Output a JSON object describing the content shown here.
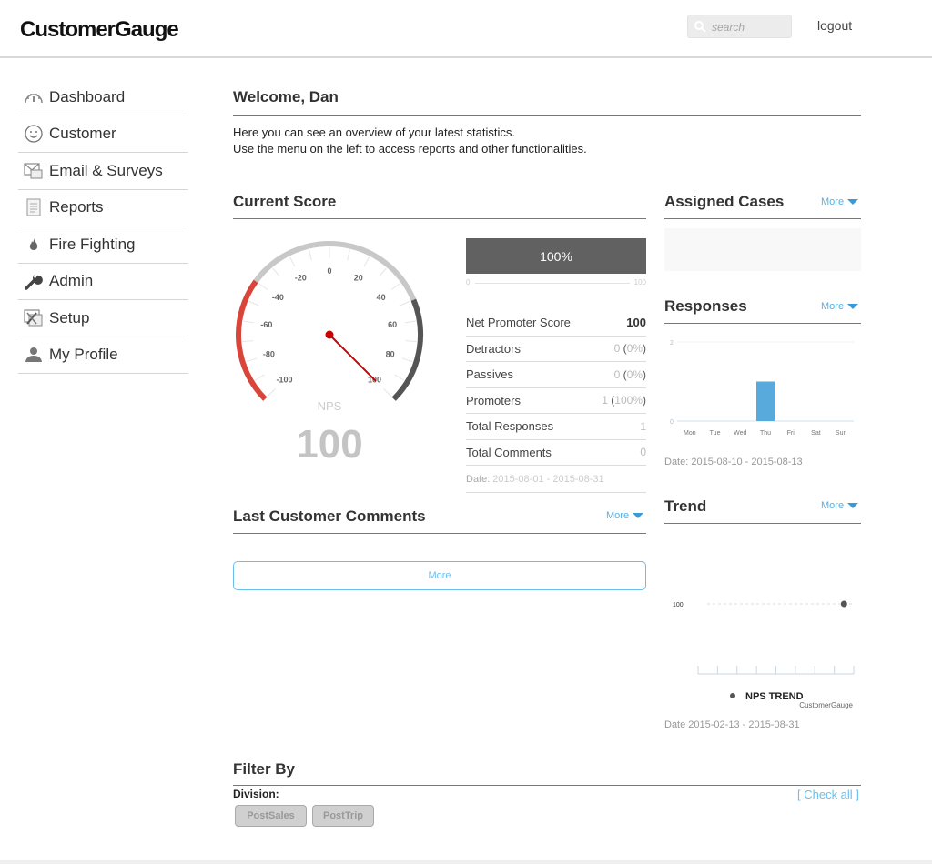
{
  "header": {
    "logo": "CustomerGauge",
    "search_placeholder": "search",
    "logout": "logout"
  },
  "sidebar": {
    "items": [
      {
        "label": "Dashboard",
        "icon": "dashboard-gauge-icon"
      },
      {
        "label": "Customer",
        "icon": "smiley-icon"
      },
      {
        "label": "Email & Surveys",
        "icon": "envelope-icon"
      },
      {
        "label": "Reports",
        "icon": "document-icon"
      },
      {
        "label": "Fire Fighting",
        "icon": "flame-icon"
      },
      {
        "label": "Admin",
        "icon": "wrench-icon"
      },
      {
        "label": "Setup",
        "icon": "setup-tools-icon"
      },
      {
        "label": "My Profile",
        "icon": "user-icon"
      }
    ]
  },
  "welcome": {
    "title": "Welcome, Dan",
    "line1": "Here you can see an overview of your latest statistics.",
    "line2": "Use the menu on the left to access reports and other functionalities."
  },
  "current_score": {
    "title": "Current Score",
    "gauge": {
      "min": -100,
      "max": 100,
      "ticks": [
        "-100",
        "-80",
        "-60",
        "-40",
        "-20",
        "0",
        "20",
        "40",
        "60",
        "80",
        "100"
      ],
      "label": "NPS",
      "value": 100,
      "value_text": "100",
      "colors": {
        "detractor_band": "#d9453a",
        "neutral_band": "#c8c8c8",
        "promoter_band": "#555555",
        "needle": "#cc0000"
      }
    },
    "progress": {
      "label": "100%",
      "value_percent": 100,
      "min_label": "0",
      "max_label": "100"
    },
    "stats": [
      {
        "label": "Net Promoter Score",
        "value": "100",
        "pct": ""
      },
      {
        "label": "Detractors",
        "value": "0",
        "pct": "0%"
      },
      {
        "label": "Passives",
        "value": "0",
        "pct": "0%"
      },
      {
        "label": "Promoters",
        "value": "1",
        "pct": "100%"
      },
      {
        "label": "Total Responses",
        "value": "1",
        "pct": ""
      },
      {
        "label": "Total Comments",
        "value": "0",
        "pct": ""
      }
    ],
    "date_label": "Date:",
    "date_range": "2015-08-01 - 2015-08-31"
  },
  "assigned_cases": {
    "title": "Assigned Cases",
    "more": "More"
  },
  "responses": {
    "title": "Responses",
    "more": "More",
    "date": "Date: 2015-08-10 - 2015-08-13"
  },
  "comments": {
    "title": "Last Customer Comments",
    "more": "More",
    "button": "More"
  },
  "trend": {
    "title": "Trend",
    "more": "More",
    "legend": "NPS TREND",
    "credit": "CustomerGauge",
    "date": "Date 2015-02-13 - 2015-08-31"
  },
  "filter": {
    "title": "Filter By",
    "division_label": "Division:",
    "check_all": "[ Check all ]",
    "chips": [
      "PostSales",
      "PostTrip"
    ]
  },
  "chart_data": [
    {
      "type": "bar",
      "title": "Responses",
      "categories": [
        "Mon",
        "Tue",
        "Wed",
        "Thu",
        "Fri",
        "Sat",
        "Sun"
      ],
      "values": [
        0,
        0,
        0,
        1,
        0,
        0,
        0
      ],
      "ylim": [
        0,
        2
      ],
      "yticks": [
        "0",
        "2"
      ],
      "color": "#58a9dc",
      "grid": true
    },
    {
      "type": "line",
      "title": "NPS TREND",
      "series": [
        {
          "name": "NPS TREND",
          "values": [
            null,
            null,
            null,
            null,
            null,
            null,
            null,
            100
          ]
        }
      ],
      "x_slots": 8,
      "yticks": [
        "100"
      ],
      "color": "#555555",
      "legend": "bottom",
      "credit": "CustomerGauge"
    }
  ]
}
